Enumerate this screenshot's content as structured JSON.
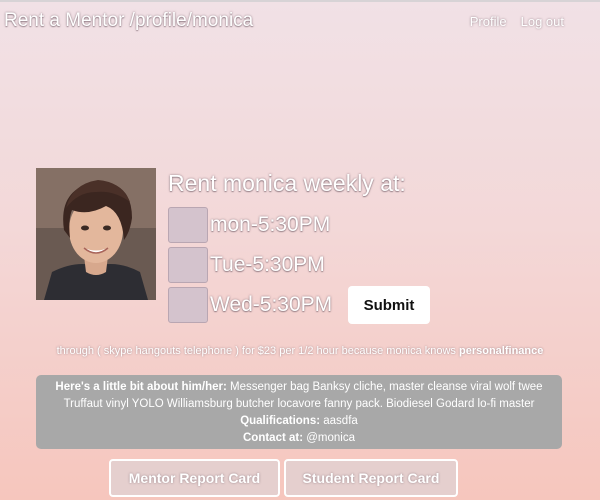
{
  "header": {
    "brand": "Rent a Mentor /profile/monica",
    "nav": {
      "profile": "Profile",
      "logout": "Log out"
    }
  },
  "rent": {
    "title": "Rent monica weekly at:",
    "slots": [
      {
        "label": "mon-5:30PM"
      },
      {
        "label": "Tue-5:30PM"
      },
      {
        "label": "Wed-5:30PM"
      }
    ],
    "submit_label": "Submit"
  },
  "through": {
    "text": "through ( skype hangouts telephone ) for $23 per 1/2 hour because monica knows ",
    "topic": "personalfinance"
  },
  "about": {
    "heading": "Here's a little bit about him/her:",
    "bio": " Messenger bag Banksy cliche, master cleanse viral wolf twee Truffaut vinyl YOLO Williamsburg butcher locavore fanny pack. Biodiesel Godard lo-fi master",
    "qualifications_label": "Qualifications:",
    "qualifications_value": " aasdfa",
    "contact_label": "Contact at:",
    "contact_value": " @monica"
  },
  "buttons": {
    "mentor_report": "Mentor Report Card",
    "student_report": "Student Report Card"
  },
  "colors": {
    "background_top": "#f1e1e6",
    "background_bottom": "#f6c6bd",
    "slot_box": "#d4c3cd",
    "about_box": "#a8a8a8",
    "report_button": "#e5cfce"
  }
}
